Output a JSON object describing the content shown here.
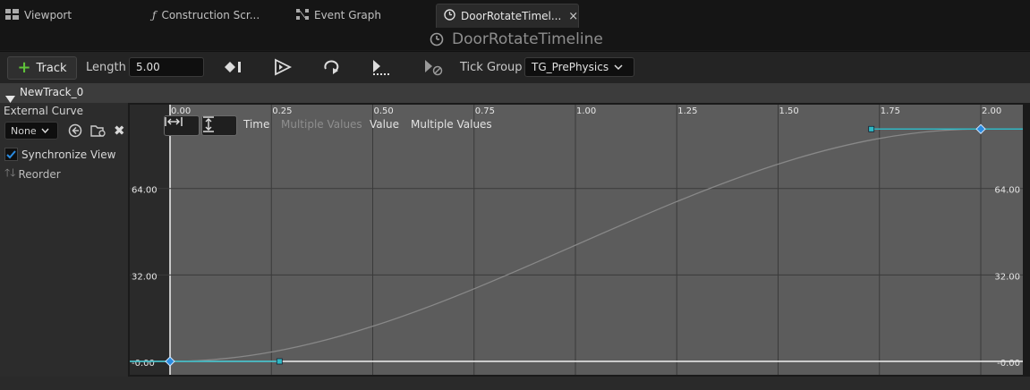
{
  "tabs": [
    {
      "label": "Viewport",
      "icon": "viewport-grid-icon"
    },
    {
      "label": "Construction Scr...",
      "icon": "function-icon"
    },
    {
      "label": "Event Graph",
      "icon": "event-graph-icon"
    },
    {
      "label": "DoorRotateTimel...",
      "icon": "clock-icon",
      "active": true
    }
  ],
  "window_title": "DoorRotateTimeline",
  "toolbar": {
    "track_label": "Track",
    "length_label": "Length",
    "length_value": "5.00",
    "tick_group_label": "Tick Group",
    "tick_group_value": "TG_PrePhysics",
    "icons": [
      "add-key-icon",
      "use-last-keyframe-icon",
      "loop-icon",
      "replicated-icon",
      "ignore-time-dilation-icon"
    ]
  },
  "track": {
    "name": "NewTrack_0",
    "external_curve_label": "External Curve",
    "external_curve_value": "None",
    "synchronize_view_label": "Synchronize View",
    "synchronize_view_checked": true,
    "reorder_label": "Reorder"
  },
  "graph": {
    "time_label": "Time",
    "time_value": "Multiple Values",
    "value_label": "Value",
    "value_value": "Multiple Values",
    "x_ticks": [
      "0.00",
      "0.25",
      "0.50",
      "0.75",
      "1.00",
      "1.25",
      "1.50",
      "1.75",
      "2.00"
    ],
    "y_ticks_left": [
      "64.00",
      "32.00",
      "-0.00"
    ],
    "y_ticks_right": [
      "64.00",
      "32.00",
      "-0.00"
    ],
    "curve_color": "#2fb8c4",
    "keys": [
      {
        "time": 0.0,
        "value": 0
      },
      {
        "time": 2.0,
        "value": 86
      }
    ]
  },
  "colors": {
    "accent_plus": "#5fc23a",
    "check": "#2a8be0"
  }
}
